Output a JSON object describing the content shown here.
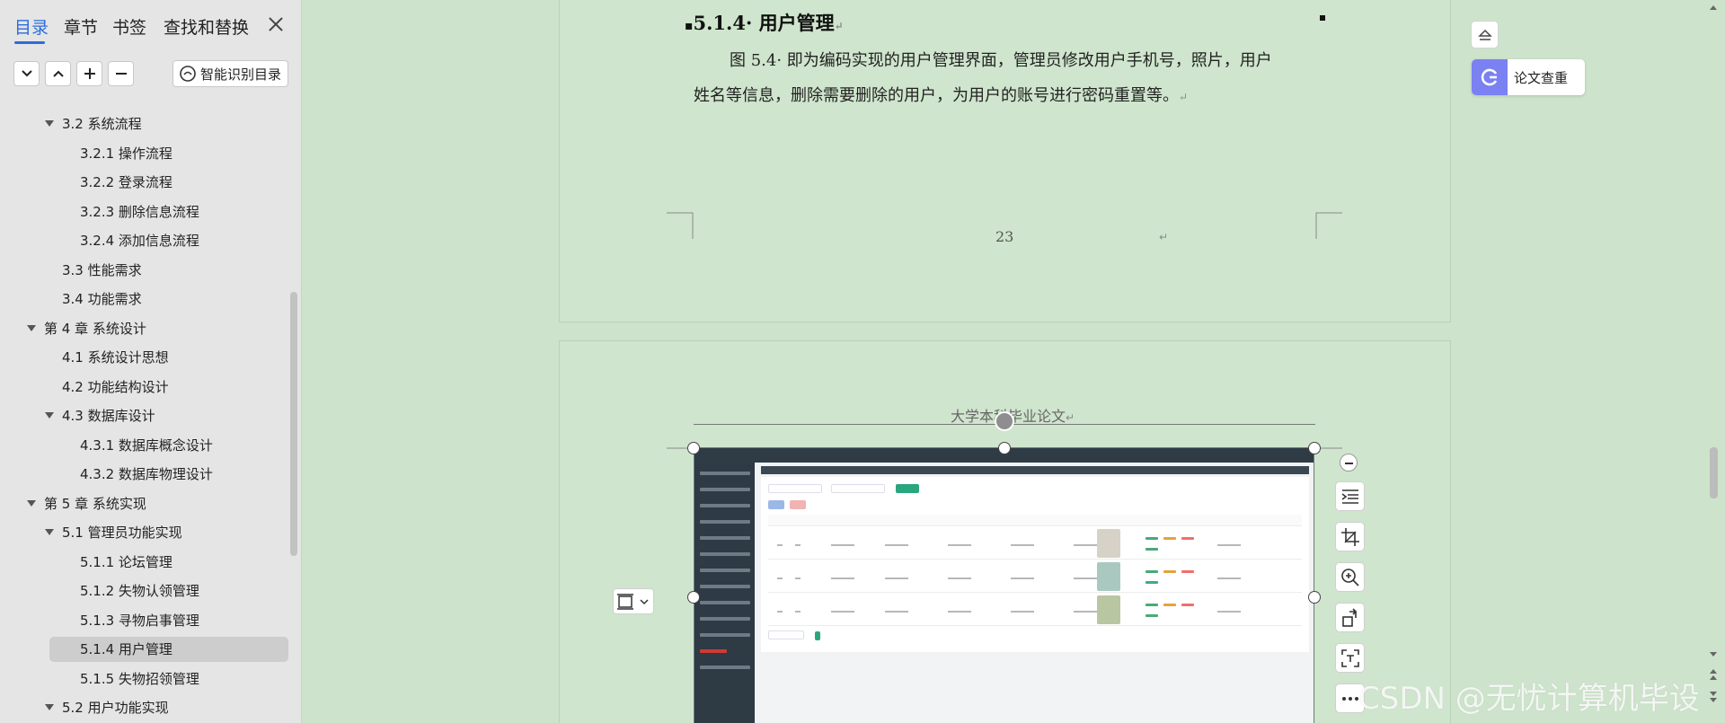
{
  "nav": {
    "tabs": [
      "目录",
      "章节",
      "书签",
      "查找和替换"
    ],
    "smart_toc_label": "智能识别目录",
    "toc": [
      {
        "text": "3.2  系统流程",
        "level": 1,
        "expanded": true
      },
      {
        "text": "3.2.1  操作流程",
        "level": 2
      },
      {
        "text": "3.2.2  登录流程",
        "level": 2
      },
      {
        "text": "3.2.3  删除信息流程",
        "level": 2
      },
      {
        "text": "3.2.4  添加信息流程",
        "level": 2
      },
      {
        "text": "3.3  性能需求",
        "level": 1
      },
      {
        "text": "3.4  功能需求",
        "level": 1
      },
      {
        "text": "第 4 章  系统设计",
        "level": 0,
        "expanded": true
      },
      {
        "text": "4.1  系统设计思想",
        "level": 1
      },
      {
        "text": "4.2  功能结构设计",
        "level": 1
      },
      {
        "text": "4.3  数据库设计",
        "level": 1,
        "expanded": true
      },
      {
        "text": "4.3.1  数据库概念设计",
        "level": 2
      },
      {
        "text": "4.3.2  数据库物理设计",
        "level": 2
      },
      {
        "text": "第 5 章  系统实现",
        "level": 0,
        "expanded": true
      },
      {
        "text": "5.1  管理员功能实现",
        "level": 1,
        "expanded": true
      },
      {
        "text": "5.1.1  论坛管理",
        "level": 2
      },
      {
        "text": "5.1.2  失物认领管理",
        "level": 2
      },
      {
        "text": "5.1.3  寻物启事管理",
        "level": 2
      },
      {
        "text": "5.1.4  用户管理",
        "level": 2,
        "selected": true
      },
      {
        "text": "5.1.5  失物招领管理",
        "level": 2
      },
      {
        "text": "5.2  用户功能实现",
        "level": 1,
        "expanded": true
      }
    ]
  },
  "document": {
    "heading": "5.1.4· 用户管理",
    "paragraph_line1": "图 5.4· 即为编码实现的用户管理界面，管理员修改用户手机号，照片，用户",
    "paragraph_line2": "姓名等信息，删除需要删除的用户，为用户的账号进行密码重置等。",
    "para_mark": "↵",
    "page_number": "23",
    "page_header": "大学本科毕业论文"
  },
  "widgets": {
    "thesis_check_label": "论文查重"
  },
  "watermark": "CSDN @无忧计算机毕设",
  "colors": {
    "accent": "#2b6ddc",
    "page_bg": "#cfe5cd",
    "check_icon": "#7b81f2"
  }
}
